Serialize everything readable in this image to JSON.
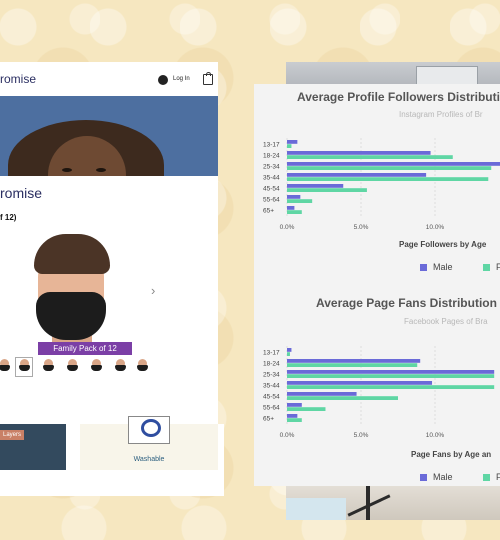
{
  "shop": {
    "brand": "romise",
    "login_label": "Log In",
    "brand_heading": "romise",
    "pack_text": "f 12)",
    "next_arrow": "›",
    "banner": "Family Pack of 12",
    "layers_tag": "Layers",
    "washable_label": "Washable"
  },
  "colors": {
    "male": "#6a6ad8",
    "female": "#5fd6a4",
    "brand": "#2b2f62",
    "banner": "#7b3fa6"
  },
  "chart_data": [
    {
      "type": "bar",
      "orientation": "horizontal",
      "title": "Average Profile Followers Distributi",
      "subtitle": "Instagram Profiles of Br",
      "xlabel": "Page Followers by Age",
      "categories": [
        "13-17",
        "18-24",
        "25-34",
        "35-44",
        "45-54",
        "55-64",
        "65+"
      ],
      "xticks": [
        "0.0%",
        "5.0%",
        "10.0%"
      ],
      "xlim": [
        0,
        14.5
      ],
      "series": [
        {
          "name": "Male",
          "values": [
            0.7,
            9.7,
            14.5,
            9.4,
            3.8,
            0.9,
            0.5
          ]
        },
        {
          "name": "F",
          "values": [
            0.3,
            11.2,
            13.8,
            13.6,
            5.4,
            1.7,
            1.0
          ]
        }
      ],
      "legend_labels": [
        "Male",
        "F"
      ]
    },
    {
      "type": "bar",
      "orientation": "horizontal",
      "title": "Average Page Fans Distribution",
      "subtitle": "Facebook Pages of Bra",
      "xlabel": "Page Fans by Age an",
      "categories": [
        "13-17",
        "18-24",
        "25-34",
        "35-44",
        "45-54",
        "55-64",
        "65+"
      ],
      "xticks": [
        "0.0%",
        "5.0%",
        "10.0%"
      ],
      "xlim": [
        0,
        14
      ],
      "series": [
        {
          "name": "Male",
          "values": [
            0.3,
            9.0,
            14.0,
            9.8,
            4.7,
            1.0,
            0.7
          ]
        },
        {
          "name": "F",
          "values": [
            0.2,
            8.8,
            14.0,
            14.0,
            7.5,
            2.6,
            1.0
          ]
        }
      ],
      "legend_labels": [
        "Male",
        "F"
      ]
    }
  ]
}
